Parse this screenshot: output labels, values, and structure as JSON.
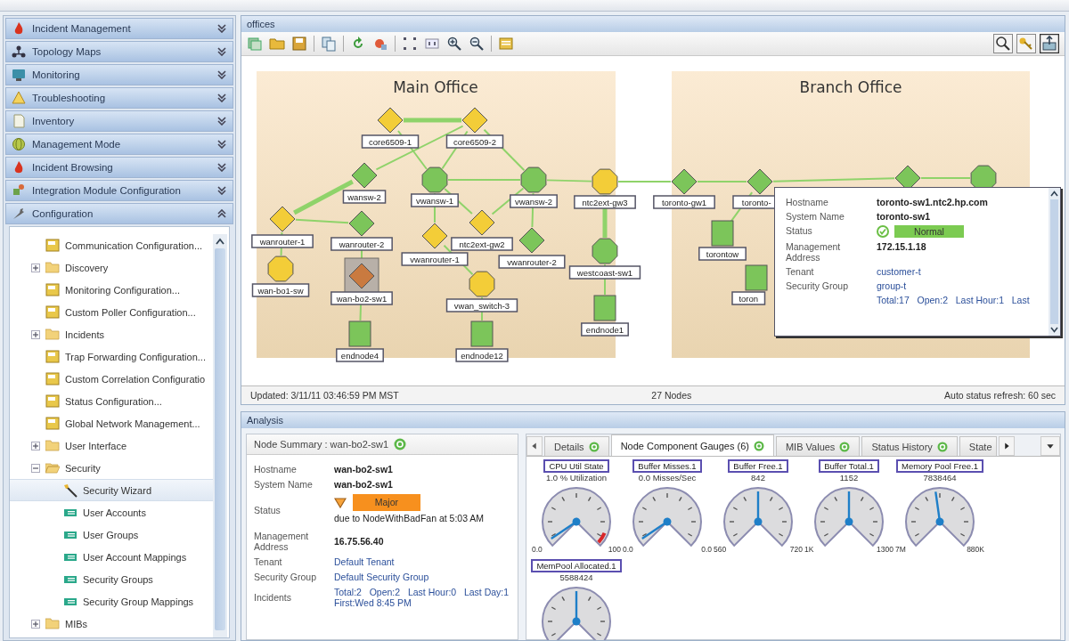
{
  "sidebar": {
    "sections": [
      {
        "label": "Incident Management",
        "expanded": false
      },
      {
        "label": "Topology Maps",
        "expanded": false
      },
      {
        "label": "Monitoring",
        "expanded": false
      },
      {
        "label": "Troubleshooting",
        "expanded": false
      },
      {
        "label": "Inventory",
        "expanded": false
      },
      {
        "label": "Management Mode",
        "expanded": false
      },
      {
        "label": "Incident Browsing",
        "expanded": false
      },
      {
        "label": "Integration Module Configuration",
        "expanded": false
      },
      {
        "label": "Configuration",
        "expanded": true
      }
    ],
    "tree": [
      {
        "kind": "config",
        "label": "Communication Configuration...",
        "selected": false
      },
      {
        "kind": "folder",
        "label": "Discovery",
        "expanded": false,
        "selected": false
      },
      {
        "kind": "config",
        "label": "Monitoring Configuration...",
        "selected": false
      },
      {
        "kind": "config",
        "label": "Custom Poller Configuration...",
        "selected": false
      },
      {
        "kind": "folder",
        "label": "Incidents",
        "expanded": false,
        "selected": false
      },
      {
        "kind": "config",
        "label": "Trap Forwarding Configuration...",
        "selected": false
      },
      {
        "kind": "config",
        "label": "Custom Correlation Configuratio",
        "selected": false
      },
      {
        "kind": "config",
        "label": "Status Configuration...",
        "selected": false
      },
      {
        "kind": "config",
        "label": "Global Network Management...",
        "selected": false
      },
      {
        "kind": "folder",
        "label": "User Interface",
        "expanded": false,
        "selected": false
      },
      {
        "kind": "folder",
        "label": "Security",
        "expanded": true,
        "selected": false,
        "children": [
          {
            "kind": "wizard",
            "label": "Security Wizard",
            "selected": true
          },
          {
            "kind": "security",
            "label": "User Accounts",
            "selected": false
          },
          {
            "kind": "security",
            "label": "User Groups",
            "selected": false
          },
          {
            "kind": "security",
            "label": "User Account Mappings",
            "selected": false
          },
          {
            "kind": "security",
            "label": "Security Groups",
            "selected": false
          },
          {
            "kind": "security",
            "label": "Security Group Mappings",
            "selected": false
          }
        ]
      },
      {
        "kind": "folder",
        "label": "MIBs",
        "expanded": false,
        "selected": false
      }
    ]
  },
  "map_panel": {
    "title": "offices",
    "regions": [
      {
        "title": "Main Office"
      },
      {
        "title": "Branch Office"
      }
    ],
    "nodes": [
      {
        "label": "core6509-1",
        "kind": "diamond",
        "color": "#f3cd38",
        "selected": false
      },
      {
        "label": "core6509-2",
        "kind": "diamond",
        "color": "#f3cd38",
        "selected": false
      },
      {
        "label": "wansw-2",
        "kind": "diamond",
        "color": "#7cc55a",
        "selected": false
      },
      {
        "label": "vwansw-1",
        "kind": "octagon",
        "color": "#7cc55a",
        "selected": false
      },
      {
        "label": "vwansw-2",
        "kind": "octagon",
        "color": "#7cc55a",
        "selected": false
      },
      {
        "label": "ntc2ext-gw3",
        "kind": "octagon",
        "color": "#f3cd38",
        "selected": false
      },
      {
        "label": "toronto-gw1",
        "kind": "diamond",
        "color": "#7cc55a",
        "selected": false
      },
      {
        "label": "toronto-",
        "kind": "diamond",
        "color": "#7cc55a",
        "selected": false
      },
      {
        "kind": "diamond",
        "color": "#7cc55a",
        "selected": false
      },
      {
        "kind": "octagon",
        "color": "#7cc55a",
        "selected": false
      },
      {
        "label": "wanrouter-1",
        "kind": "diamond",
        "color": "#f3cd38",
        "selected": false
      },
      {
        "label": "wanrouter-2",
        "kind": "diamond",
        "color": "#7cc55a",
        "selected": false
      },
      {
        "label": "vwanrouter-1",
        "kind": "diamond",
        "color": "#f3cd38",
        "selected": false
      },
      {
        "label": "ntc2ext-gw2",
        "kind": "diamond",
        "color": "#f3cd38",
        "selected": false
      },
      {
        "label": "vwanrouter-2",
        "kind": "diamond",
        "color": "#7cc55a",
        "selected": false
      },
      {
        "label": "westcoast-sw1",
        "kind": "octagon",
        "color": "#7cc55a",
        "selected": false
      },
      {
        "label": "wan-bo1-sw",
        "kind": "octagon",
        "color": "#f3cd38",
        "selected": false
      },
      {
        "label": "wan-bo2-sw1",
        "kind": "diamond",
        "color": "#c97a40",
        "selected": true
      },
      {
        "label": "vwan_switch-3",
        "kind": "octagon",
        "color": "#f3cd38",
        "selected": false
      },
      {
        "label": "endnode4",
        "kind": "square",
        "color": "#7cc55a",
        "selected": false
      },
      {
        "label": "endnode12",
        "kind": "square",
        "color": "#7cc55a",
        "selected": false
      },
      {
        "label": "endnode1",
        "kind": "square",
        "color": "#7cc55a",
        "selected": false
      },
      {
        "label": "torontow",
        "kind": "square",
        "color": "#7cc55a",
        "selected": false
      },
      {
        "label": "toron",
        "kind": "square",
        "color": "#7cc55a",
        "selected": false
      }
    ],
    "popup": {
      "rows": [
        {
          "kind": "text",
          "label": "Hostname",
          "value": "toronto-sw1.ntc2.hp.com"
        },
        {
          "kind": "text",
          "label": "System Name",
          "value": "toronto-sw1"
        },
        {
          "kind": "status",
          "label": "Status",
          "color": "#7ccb52",
          "value": "Normal"
        },
        {
          "kind": "text",
          "label": "Management Address",
          "value": "172.15.1.18"
        },
        {
          "kind": "link",
          "label": "Tenant",
          "value": "customer-t"
        },
        {
          "kind": "link",
          "label": "Security Group",
          "value": "group-t"
        },
        {
          "kind": "link",
          "value": "Total:17   Open:2   Last Hour:1   Last"
        }
      ]
    },
    "status_bar": {
      "updated": "Updated: 3/11/11 03:46:59 PM MST",
      "count": "27 Nodes",
      "refresh": "Auto status refresh: 60 sec"
    }
  },
  "analysis": {
    "title": "Analysis",
    "summary": {
      "title": "Node Summary : wan-bo2-sw1",
      "rows": [
        {
          "kind": "text",
          "label": "Hostname",
          "value": "wan-bo2-sw1"
        },
        {
          "kind": "text",
          "label": "System Name",
          "value": "wan-bo2-sw1"
        },
        {
          "kind": "status",
          "label": "Status",
          "color": "#f7901e",
          "value": "Major",
          "note": "due to NodeWithBadFan at 5:03 AM"
        },
        {
          "kind": "text",
          "label": "Management Address",
          "value": "16.75.56.40"
        },
        {
          "kind": "link",
          "label": "Tenant",
          "value": "Default Tenant"
        },
        {
          "kind": "link",
          "label": "Security Group",
          "value": "Default Security Group"
        },
        {
          "kind": "link",
          "label": "Incidents",
          "value": "Total:2   Open:2   Last Hour:0   Last Day:1   First:Wed 8:45 PM"
        }
      ]
    },
    "tabs": [
      {
        "label": "Details",
        "selected": false,
        "refresh_icon": true
      },
      {
        "label": "Node Component Gauges (6)",
        "selected": true,
        "refresh_icon": true
      },
      {
        "label": "MIB Values",
        "selected": false,
        "refresh_icon": true
      },
      {
        "label": "Status History",
        "selected": false,
        "refresh_icon": true
      },
      {
        "label": "State",
        "selected": false,
        "refresh_icon": false
      }
    ],
    "gauges": [
      {
        "title": "CPU Util State",
        "reading": "1.0 % Utilization",
        "min": "0.0",
        "max": "100",
        "alarm": true
      },
      {
        "title": "Buffer Misses.1",
        "reading": "0.0 Misses/Sec",
        "min": "0.0",
        "max": "0.0",
        "alarm": false
      },
      {
        "title": "Buffer Free.1",
        "reading": "842",
        "min": "560",
        "max": "720",
        "alarm": false
      },
      {
        "title": "Buffer Total.1",
        "reading": "1152",
        "min": "1K",
        "max": "1300",
        "alarm": false
      },
      {
        "title": "Memory Pool Free.1",
        "reading": "7838464",
        "min": "7M",
        "max": "880K",
        "alarm": false
      },
      {
        "title": "MemPool Allocated.1",
        "reading": "5588424",
        "alarm": false
      }
    ]
  }
}
